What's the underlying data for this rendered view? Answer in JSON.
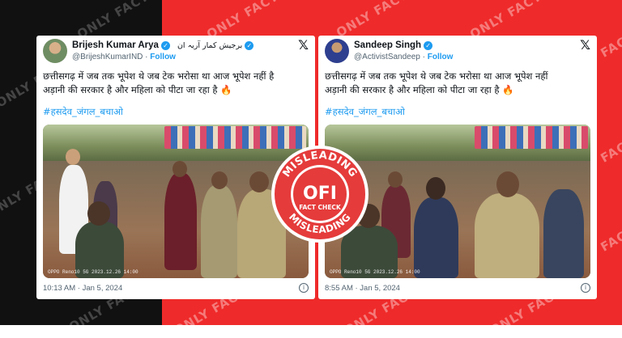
{
  "watermark": "ONLY FACT",
  "brand_colors": {
    "left_bg": "#111111",
    "right_bg": "#ef2a2a",
    "twitter_blue": "#1d9bf0"
  },
  "tweets": [
    {
      "name": "Brijesh Kumar Arya",
      "name_alt": "برجیش کمار آریہ ان",
      "handle": "@BrijeshKumarIND",
      "follow": "Follow",
      "text_line1": "छत्तीसगढ़ में जब तक भूपेश थे जब टेक भरोसा था आज भूपेश नहीं है",
      "text_line2": "अड़ानी की सरकार है और महिला को पीटा जा रहा है",
      "emoji": "🔥",
      "hashtag": "#हसदेव_जंगल_बचाओ",
      "video_stamp": "OPPO Reno10 5G  2023.12.26 14:00",
      "timestamp": "10:13 AM · Jan 5, 2024",
      "x_logo": "𝕏",
      "info_icon": "i"
    },
    {
      "name": "Sandeep Singh",
      "name_alt": "",
      "handle": "@ActivistSandeep",
      "follow": "Follow",
      "text_line1": "छत्तीसगढ़ में जब तक भूपेश थे जब टेक भरोसा था आज भूपेश नहीं",
      "text_line2": "अड़ानी की सरकार है और महिला को पीटा जा रहा है",
      "emoji": "🔥",
      "hashtag": "#हसदेव_जंगल_बचाओ",
      "video_stamp": "OPPO Reno10 5G  2023.12.26 14:00",
      "timestamp": "8:55 AM · Jan 5, 2024",
      "x_logo": "𝕏",
      "info_icon": "i"
    }
  ],
  "badge": {
    "top_text": "MISLEADING",
    "logo": "OFI",
    "sub_text": "FACT CHECK",
    "bottom_text": "MISLEADING",
    "color": "#e53b3b"
  }
}
